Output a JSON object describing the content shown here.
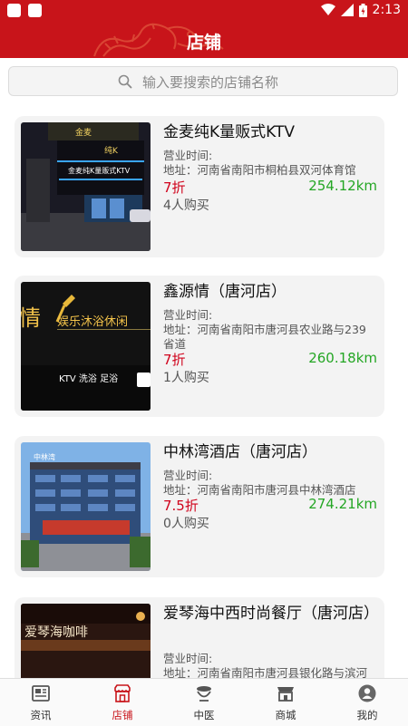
{
  "status_bar": {
    "time": "2:13"
  },
  "header": {
    "title": "店铺"
  },
  "search": {
    "placeholder": "输入要搜索的店铺名称"
  },
  "shops": [
    {
      "name": "金麦纯K量贩式KTV",
      "hours_label": "营业时间:",
      "address": "地址：河南省南阳市桐柏县双河体育馆",
      "discount": "7折",
      "distance": "254.12km",
      "buyers": "4人购买",
      "thumb_text": [
        "金麦",
        "纯K",
        "金麦纯K量贩式KTV"
      ]
    },
    {
      "name": "鑫源情（唐河店）",
      "hours_label": "营业时间:",
      "address": "地址：河南省南阳市唐河县农业路与239省道",
      "discount": "7折",
      "distance": "260.18km",
      "buyers": "1人购买",
      "thumb_text": [
        "情",
        "娱乐沐浴休闲",
        "KTV 洗浴 足浴"
      ]
    },
    {
      "name": "中林湾酒店（唐河店）",
      "hours_label": "营业时间:",
      "address": "地址：河南省南阳市唐河县中林湾酒店",
      "discount": "7.5折",
      "distance": "274.21km",
      "buyers": "0人购买",
      "thumb_text": [
        "中林湾"
      ]
    },
    {
      "name": "爱琴海中西时尚餐厅（唐河店）",
      "hours_label": "营业时间:",
      "address": "地址：河南省南阳市唐河县银化路与滨河",
      "thumb_text": [
        "爱琴海咖啡"
      ]
    }
  ],
  "tabs": [
    {
      "label": "资讯",
      "icon": "news-icon",
      "active": false
    },
    {
      "label": "店铺",
      "icon": "shop-icon",
      "active": true
    },
    {
      "label": "中医",
      "icon": "tcm-icon",
      "active": false
    },
    {
      "label": "商城",
      "icon": "mall-icon",
      "active": false
    },
    {
      "label": "我的",
      "icon": "profile-icon",
      "active": false
    }
  ],
  "colors": {
    "primary": "#c8141a",
    "discount": "#d0021b",
    "distance": "#24a624"
  }
}
